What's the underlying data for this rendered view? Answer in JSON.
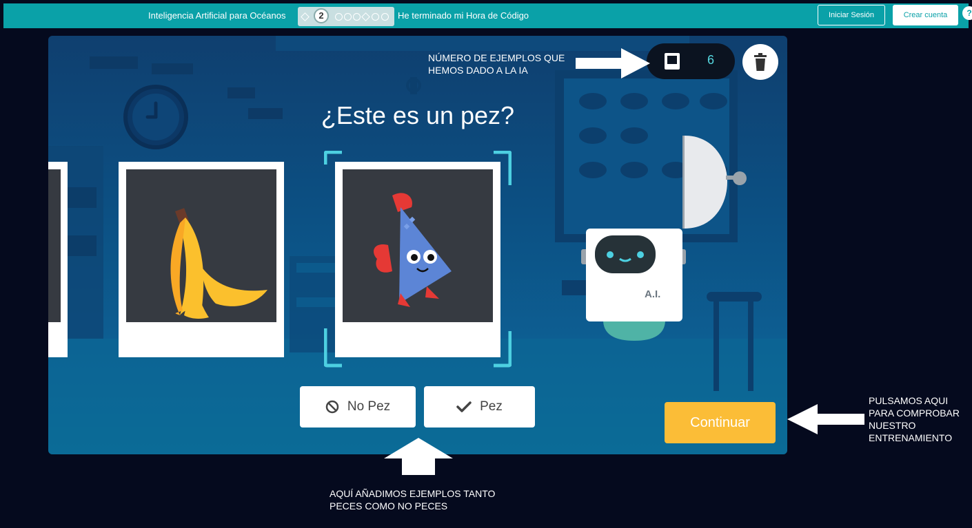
{
  "topbar": {
    "course_title": "Inteligencia Artificial para Océanos",
    "current_level": "2",
    "finish_text": "He terminado mi Hora de Código",
    "signin_label": "Iniciar Sesión",
    "create_account_label": "Crear cuenta",
    "help_label": "?"
  },
  "game": {
    "question": "¿Este es un pez?",
    "examples_count": "6",
    "cards": [
      "banana-peel",
      "fish"
    ],
    "ai_badge": "A.I.",
    "no_fish_label": "No Pez",
    "fish_label": "Pez",
    "continue_label": "Continuar"
  },
  "annotations": {
    "counter_note": "NÚMERO DE EJEMPLOS QUE\nHEMOS DADO A LA IA",
    "buttons_note": "AQUÍ AÑADIMOS EJEMPLOS TANTO\nPECES COMO NO PECES",
    "continue_note": "PULSAMOS AQUI\nPARA COMPROBAR\nNUESTRO\nENTRENAMIENTO"
  },
  "colors": {
    "topbar": "#0aa1a8",
    "page_background": "#050a1e",
    "continue_button": "#fbbd37",
    "counter_text": "#56d8e0"
  },
  "icons": [
    "clock-icon",
    "trash-icon",
    "block-icon",
    "check-icon",
    "help-icon",
    "counter-icon"
  ]
}
